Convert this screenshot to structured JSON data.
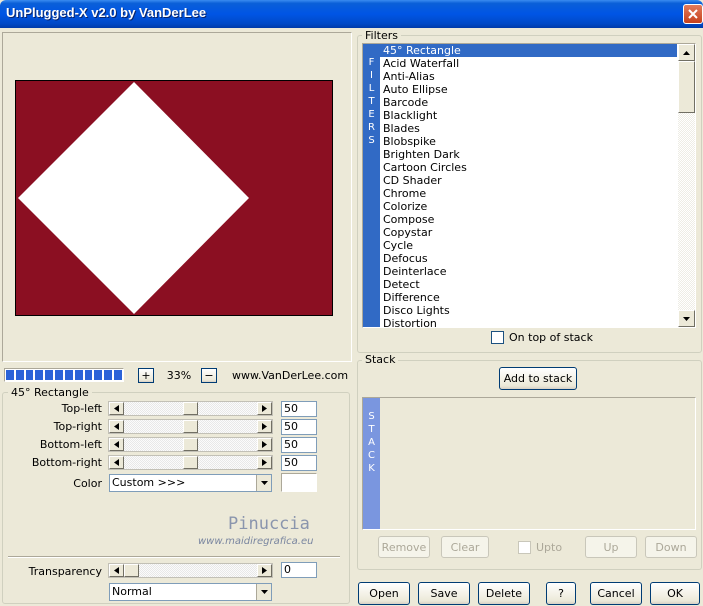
{
  "window": {
    "title": "UnPlugged-X v2.0 by VanDerLee"
  },
  "colors": {
    "preview_bg": "#8b0f22",
    "titlebar": "#0055e5",
    "selection": "#316ac5"
  },
  "preview": {
    "zoom": "33%",
    "zoom_plus": "+",
    "zoom_minus": "−",
    "website": "www.VanDerLee.com"
  },
  "params": {
    "group_label": "45° Rectangle",
    "sliders": [
      {
        "label": "Top-left",
        "value": "50"
      },
      {
        "label": "Top-right",
        "value": "50"
      },
      {
        "label": "Bottom-left",
        "value": "50"
      },
      {
        "label": "Bottom-right",
        "value": "50"
      }
    ],
    "color_label": "Color",
    "color_value": "Custom >>>",
    "watermark_name": "Pinuccia",
    "watermark_url": "www.maidiregrafica.eu",
    "transparency_label": "Transparency",
    "transparency_value": "0",
    "blend_mode": "Normal"
  },
  "filters": {
    "group_label": "Filters",
    "vertical_letters": [
      "F",
      "I",
      "L",
      "T",
      "E",
      "R",
      "S"
    ],
    "items": [
      "45° Rectangle",
      "Acid Waterfall",
      "Anti-Alias",
      "Auto Ellipse",
      "Barcode",
      "Blacklight",
      "Blades",
      "Blobspike",
      "Brighten Dark",
      "Cartoon Circles",
      "CD Shader",
      "Chrome",
      "Colorize",
      "Compose",
      "Copystar",
      "Cycle",
      "Defocus",
      "Deinterlace",
      "Detect",
      "Difference",
      "Disco Lights",
      "Distortion"
    ],
    "on_top_label": "On top of stack"
  },
  "stack": {
    "group_label": "Stack",
    "add_label": "Add to stack",
    "vertical_letters": [
      "S",
      "T",
      "A",
      "C",
      "K"
    ],
    "remove_label": "Remove",
    "clear_label": "Clear",
    "upto_label": "Upto",
    "up_label": "Up",
    "down_label": "Down"
  },
  "buttons": {
    "open": "Open",
    "save": "Save",
    "delete": "Delete",
    "help": "?",
    "cancel": "Cancel",
    "ok": "OK"
  }
}
